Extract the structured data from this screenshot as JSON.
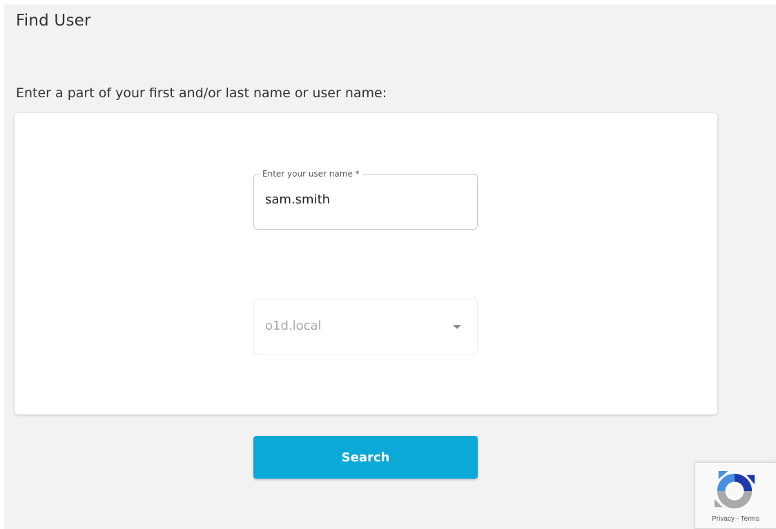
{
  "page": {
    "title": "Find User",
    "instruction": "Enter a part of your first and/or last name or user name:"
  },
  "username_field": {
    "label": "Enter your user name *",
    "value": "sam.smith"
  },
  "domain_select": {
    "selected": "o1d.local"
  },
  "search_button": {
    "label": "Search"
  },
  "recaptcha": {
    "privacy_label": "Privacy",
    "separator": " - ",
    "terms_label": "Terms"
  },
  "colors": {
    "background": "#f2f2f2",
    "card": "#ffffff",
    "accent": "#0aa9d8",
    "recaptcha_blue": "#1c3aa9",
    "recaptcha_light_blue": "#4a90e2",
    "recaptcha_gray": "#aaaaaa"
  }
}
